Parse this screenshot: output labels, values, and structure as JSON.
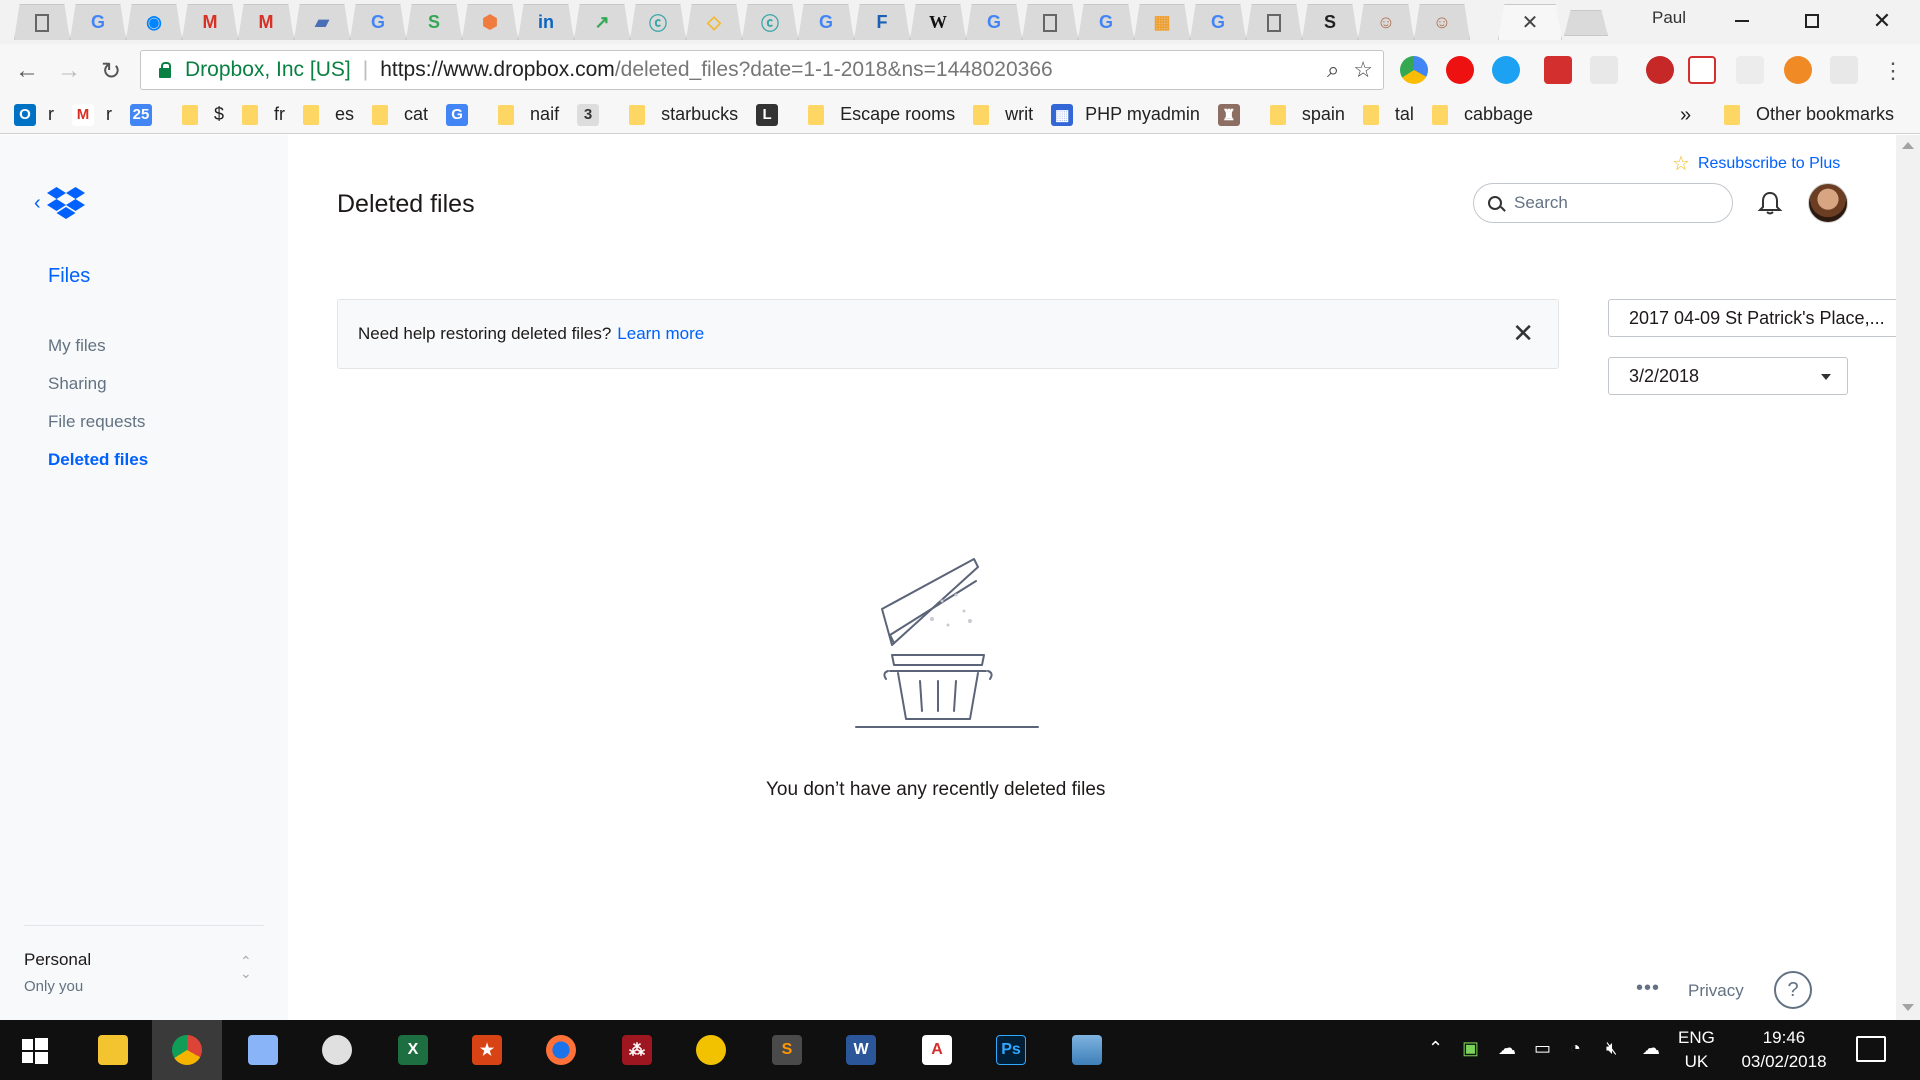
{
  "browser": {
    "profile_name": "Paul",
    "active_tab_close": "✕",
    "site_identity": "Dropbox, Inc [US]",
    "url_host": "https://www.dropbox.com",
    "url_path": "/deleted_files?date=1-1-2018&ns=1448020366",
    "bookmarks": [
      {
        "label": "r",
        "icon": "outlook-icon"
      },
      {
        "label": "r",
        "icon": "gmail-icon"
      },
      {
        "label": "",
        "icon": "calendar-icon"
      },
      {
        "label": "$",
        "icon": "folder-icon"
      },
      {
        "label": "fr",
        "icon": "folder-icon"
      },
      {
        "label": "es",
        "icon": "folder-icon"
      },
      {
        "label": "cat",
        "icon": "folder-icon"
      },
      {
        "label": "",
        "icon": "translate-icon"
      },
      {
        "label": "naif",
        "icon": "folder-icon"
      },
      {
        "label": "",
        "icon": "three-icon"
      },
      {
        "label": "starbucks",
        "icon": "folder-icon"
      },
      {
        "label": "",
        "icon": "lync-icon"
      },
      {
        "label": "Escape rooms",
        "icon": "folder-icon"
      },
      {
        "label": "writ",
        "icon": "folder-icon"
      },
      {
        "label": "PHP myadmin",
        "icon": "grid-icon"
      },
      {
        "label": "",
        "icon": "castle-icon"
      },
      {
        "label": "spain",
        "icon": "folder-icon"
      },
      {
        "label": "tal",
        "icon": "folder-icon"
      },
      {
        "label": "cabbage",
        "icon": "folder-icon"
      }
    ],
    "bookmarks_overflow": "»",
    "other_bookmarks": "Other bookmarks"
  },
  "sidebar": {
    "section_title": "Files",
    "items": [
      {
        "label": "My files",
        "active": false
      },
      {
        "label": "Sharing",
        "active": false
      },
      {
        "label": "File requests",
        "active": false
      },
      {
        "label": "Deleted files",
        "active": true
      }
    ],
    "account_name": "Personal",
    "account_sub": "Only you"
  },
  "header": {
    "resubscribe": "Resubscribe to Plus",
    "title": "Deleted files",
    "search_placeholder": "Search"
  },
  "banner": {
    "text": "Need help restoring deleted files?",
    "link": "Learn more",
    "close": "✕"
  },
  "filters": {
    "folder": "2017 04-09 St Patrick's Place,...",
    "date": "3/2/2018"
  },
  "empty_state": {
    "message": "You don’t have any recently deleted files"
  },
  "footer": {
    "more": "•••",
    "privacy": "Privacy",
    "help": "?"
  },
  "taskbar": {
    "language": [
      "ENG",
      "UK"
    ],
    "time": "19:46",
    "date": "03/02/2018"
  },
  "colors": {
    "accent": "#0061fe",
    "sidebar_bg": "#f7f9fa",
    "taskbar_bg": "#101010"
  }
}
